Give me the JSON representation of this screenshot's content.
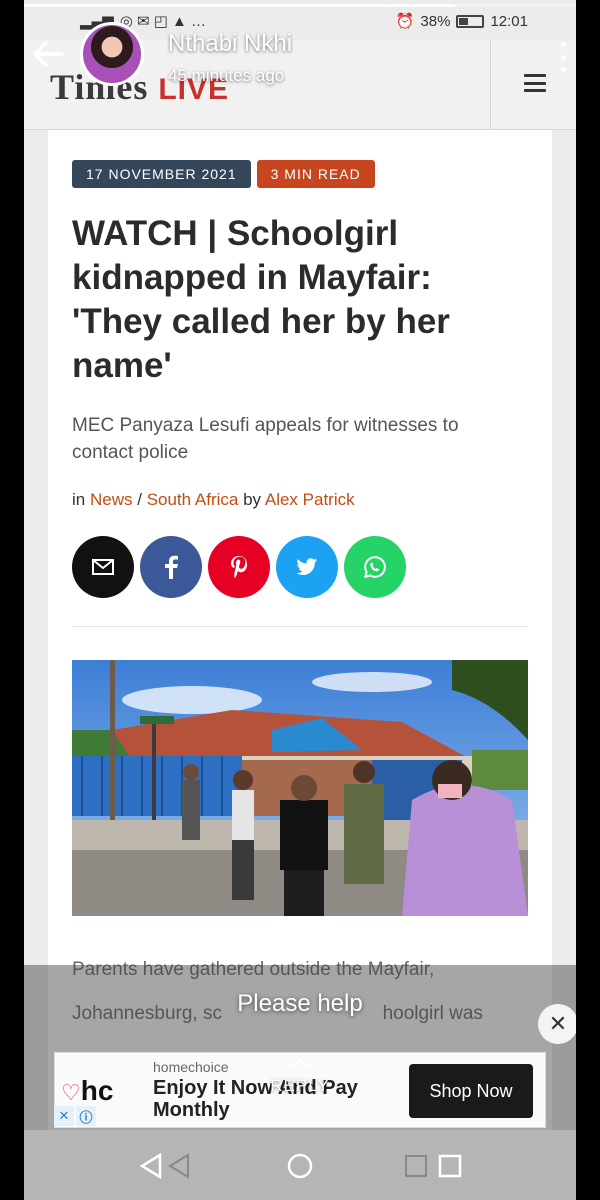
{
  "status_bar": {
    "battery": "38%",
    "time": "12:01"
  },
  "story": {
    "user_name": "Nthabi Nkhi",
    "time_ago": "45 minutes ago",
    "caption": "Please help",
    "reply_label": "REPLY",
    "progress_fraction": 0.78
  },
  "site": {
    "logo_main": "Times",
    "logo_accent": "LIVE"
  },
  "article": {
    "date_badge": "17 NOVEMBER 2021",
    "read_badge": "3 MIN READ",
    "headline": "WATCH | Schoolgirl kidnapped in Mayfair: 'They called her by her name'",
    "subtitle": "MEC Panyaza Lesufi appeals for witnesses to contact police",
    "byline": {
      "prefix": "in",
      "category": "News",
      "separator": "/",
      "subcategory": "South Africa",
      "by": "by",
      "author": "Alex Patrick"
    },
    "share_icons": [
      "envelope-icon",
      "facebook-icon",
      "pinterest-icon",
      "twitter-icon",
      "whatsapp-icon"
    ],
    "body_line_1": "Parents have gathered outside the Mayfair,",
    "body_line_2": "Johannesburg, sc",
    "body_line_2_end": "hoolgirl was"
  },
  "ad": {
    "logo_text": "hc",
    "brand": "homechoice",
    "title": "Enjoy It Now And Pay Monthly",
    "cta": "Shop Now",
    "close_symbol": "✕"
  },
  "colors": {
    "date_badge": "#34465a",
    "read_badge": "#c7451f",
    "link": "#c44b12",
    "logo_accent": "#c9302c"
  }
}
